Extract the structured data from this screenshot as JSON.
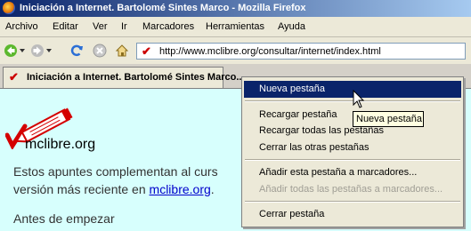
{
  "window": {
    "title": "Iniciación a Internet. Bartolomé Sintes Marco - Mozilla Firefox"
  },
  "menubar": [
    "Archivo",
    "Editar",
    "Ver",
    "Ir",
    "Marcadores",
    "Herramientas",
    "Ayuda"
  ],
  "navbar": {
    "url": "http://www.mclibre.org/consultar/internet/index.html"
  },
  "tab": {
    "label": "Iniciación a Internet. Bartolomé Sintes Marco"
  },
  "page": {
    "logo_text": "mclibre.org",
    "para_line1": "Estos apuntes complementan al curs",
    "para_line2_prefix": "versión más reciente en ",
    "para_link": "mclibre.org",
    "para_line2_suffix": ".",
    "heading": "Antes de empezar"
  },
  "context_menu": {
    "items": [
      {
        "label": "Nueva pestaña",
        "state": "selected"
      },
      {
        "label": "Recargar pestaña",
        "state": "normal"
      },
      {
        "label": "Recargar todas las pestañas",
        "state": "normal"
      },
      {
        "label": "Cerrar las otras pestañas",
        "state": "normal"
      },
      {
        "label": "Añadir esta pestaña a marcadores...",
        "state": "normal"
      },
      {
        "label": "Añadir todas las pestañas a marcadores...",
        "state": "disabled"
      },
      {
        "label": "Cerrar pestaña",
        "state": "normal"
      }
    ]
  },
  "tooltip": {
    "text": "Nueva pestaña"
  },
  "colors": {
    "titlebar": "#0a246a",
    "selection": "#0a246a",
    "content_bg": "#d7fffd",
    "link": "#0000cc"
  }
}
